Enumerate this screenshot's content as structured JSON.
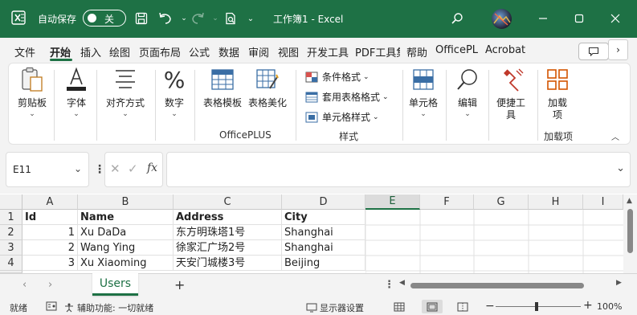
{
  "titlebar": {
    "autosave_label": "自动保存",
    "autosave_state": "关",
    "title": "工作簿1  -  Excel",
    "colors": {
      "bg": "#1e7145"
    }
  },
  "tabs": [
    {
      "label": "文件"
    },
    {
      "label": "开始",
      "active": true
    },
    {
      "label": "插入"
    },
    {
      "label": "绘图"
    },
    {
      "label": "页面布局"
    },
    {
      "label": "公式"
    },
    {
      "label": "数据"
    },
    {
      "label": "审阅"
    },
    {
      "label": "视图"
    },
    {
      "label": "开发工具"
    },
    {
      "label": "PDF工具集"
    },
    {
      "label": "帮助"
    },
    {
      "label": "OfficePL"
    },
    {
      "label": "Acrobat"
    }
  ],
  "ribbon": {
    "clipboard": "剪贴板",
    "font": "字体",
    "align": "对齐方式",
    "number": "数字",
    "table_template": "表格模板",
    "table_beautify": "表格美化",
    "officeplus_group": "OfficePLUS",
    "cond_format": "条件格式",
    "table_format": "套用表格格式",
    "cell_style": "单元格样式",
    "style_group": "样式",
    "cells": "单元格",
    "edit": "编辑",
    "convenience_tool": "便捷工具",
    "addin": "加载项",
    "addin_group": "加载项"
  },
  "formula_bar": {
    "name_box": "E11",
    "formula": ""
  },
  "grid": {
    "columns": [
      "A",
      "B",
      "C",
      "D",
      "E",
      "F",
      "G",
      "H",
      "I"
    ],
    "selected_column": "E",
    "rows": [
      {
        "num": "1",
        "cells": [
          "Id",
          "Name",
          "Address",
          "City"
        ]
      },
      {
        "num": "2",
        "cells": [
          "1",
          "Xu DaDa",
          "东方明珠塔1号",
          "Shanghai"
        ]
      },
      {
        "num": "3",
        "cells": [
          "2",
          "Wang Ying",
          "徐家汇广场2号",
          "Shanghai"
        ]
      },
      {
        "num": "4",
        "cells": [
          "3",
          "Xu Xiaoming",
          "天安门城楼3号",
          "Beijing"
        ]
      }
    ]
  },
  "sheets": [
    {
      "name": "Users",
      "active": true
    }
  ],
  "statusbar": {
    "ready": "就绪",
    "accessibility": "辅助功能: 一切就绪",
    "display_settings": "显示器设置",
    "zoom": "100%"
  }
}
